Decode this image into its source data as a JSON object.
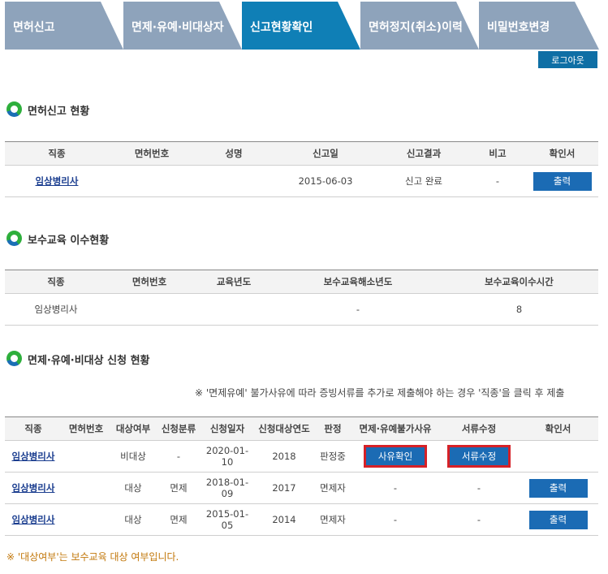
{
  "tabs": [
    {
      "label": "면허신고",
      "active": false
    },
    {
      "label": "면제·유예·비대상자",
      "active": false
    },
    {
      "label": "신고현황확인",
      "active": true
    },
    {
      "label": "면허정지(취소)이력",
      "active": false
    },
    {
      "label": "비밀번호변경",
      "active": false
    }
  ],
  "logout_label": "로그아웃",
  "sections": {
    "license": {
      "title": "면허신고 현황",
      "headers": [
        "직종",
        "면허번호",
        "성명",
        "신고일",
        "신고결과",
        "비고",
        "확인서"
      ],
      "rows": [
        {
          "job": "임상병리사",
          "license_no": "",
          "name": "",
          "date": "2015-06-03",
          "result": "신고 완료",
          "note": "-",
          "action": "출력"
        }
      ]
    },
    "education": {
      "title": "보수교육 이수현황",
      "headers": [
        "직종",
        "면허번호",
        "교육년도",
        "보수교육해소년도",
        "보수교육이수시간"
      ],
      "rows": [
        {
          "job": "임상병리사",
          "license_no": "",
          "year": "",
          "resolved": "-",
          "hours": "8"
        }
      ]
    },
    "exemption": {
      "title": "면제·유예·비대상 신청 현황",
      "notice": "※ '면제유예' 불가사유에 따라 증빙서류를 추가로 제출해야 하는 경우 '직종'을 클릭 후 제출",
      "headers": [
        "직종",
        "면허번호",
        "대상여부",
        "신청분류",
        "신청일자",
        "신청대상연도",
        "판정",
        "면제·유예불가사유",
        "서류수정",
        "확인서"
      ],
      "rows": [
        {
          "job": "임상병리사",
          "license_no": "",
          "target": "비대상",
          "category": "-",
          "date": "2020-01-10",
          "year": "2018",
          "verdict": "판정중",
          "reason": "사유확인",
          "docs": "서류수정",
          "cert": ""
        },
        {
          "job": "임상병리사",
          "license_no": "",
          "target": "대상",
          "category": "면제",
          "date": "2018-01-09",
          "year": "2017",
          "verdict": "면제자",
          "reason": "-",
          "docs": "-",
          "cert": "출력"
        },
        {
          "job": "임상병리사",
          "license_no": "",
          "target": "대상",
          "category": "면제",
          "date": "2015-01-05",
          "year": "2014",
          "verdict": "면제자",
          "reason": "-",
          "docs": "-",
          "cert": "출력"
        }
      ]
    }
  },
  "footnote": "※ '대상여부'는 보수교육 대상 여부입니다.",
  "colors": {
    "tab_inactive": "#8ea3bb",
    "tab_active": "#0f7fb6",
    "button": "#1b6bb4",
    "highlight": "#d62127",
    "footnote": "#c2770a"
  }
}
